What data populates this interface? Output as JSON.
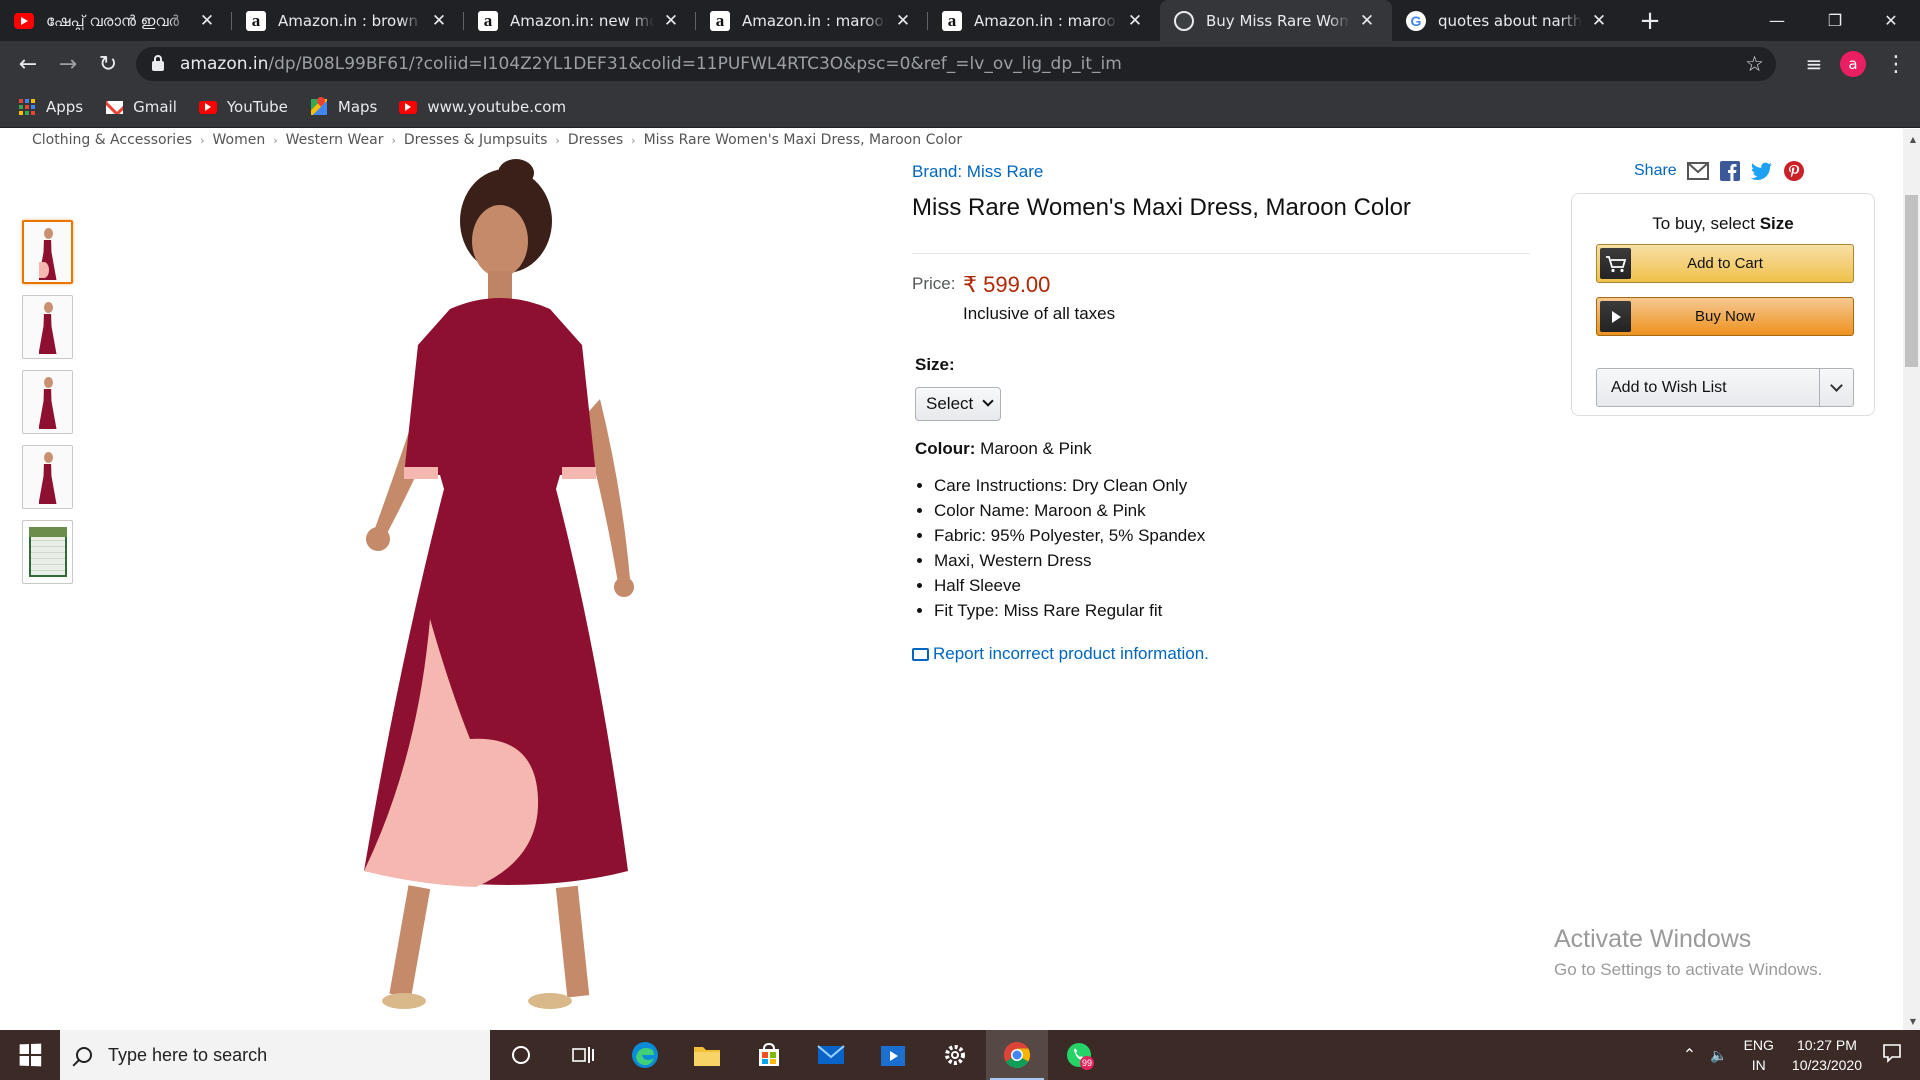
{
  "browser": {
    "tabs": [
      {
        "title": "ഷേപ്പ് വരാൻ ഇവർ",
        "icon": "youtube-icon"
      },
      {
        "title": "Amazon.in : brown blac",
        "icon": "amazon-icon"
      },
      {
        "title": "Amazon.in: new model",
        "icon": "amazon-icon"
      },
      {
        "title": "Amazon.in : maroon dr",
        "icon": "amazon-icon"
      },
      {
        "title": "Amazon.in : maroon dr",
        "icon": "amazon-icon"
      },
      {
        "title": "Buy Miss Rare Women",
        "icon": "globe-icon",
        "active": true
      },
      {
        "title": "quotes about narthaki",
        "icon": "google-icon"
      }
    ],
    "url_host": "amazon.in",
    "url_path": "/dp/B08L99BF61/?coliid=I104Z2YL1DEF31&colid=11PUFWL4RTC3O&psc=0&ref_=lv_ov_lig_dp_it_im",
    "avatar_letter": "a",
    "bookmarks": [
      {
        "label": "Apps",
        "icon": "apps-grid-icon"
      },
      {
        "label": "Gmail",
        "icon": "gmail-icon"
      },
      {
        "label": "YouTube",
        "icon": "youtube-icon"
      },
      {
        "label": "Maps",
        "icon": "maps-icon"
      },
      {
        "label": "www.youtube.com",
        "icon": "youtube-icon"
      }
    ]
  },
  "breadcrumb": [
    "Clothing & Accessories",
    "Women",
    "Western Wear",
    "Dresses & Jumpsuits",
    "Dresses",
    "Miss Rare Women's Maxi Dress, Maroon Color"
  ],
  "product": {
    "brand": "Brand: Miss Rare",
    "title": "Miss Rare Women's Maxi Dress, Maroon Color",
    "price_label": "Price:",
    "price": "₹ 599.00",
    "taxes": "Inclusive of all taxes",
    "size_label": "Size:",
    "size_selected": "Select",
    "colour_label": "Colour:",
    "colour_value": "Maroon & Pink",
    "bullets": [
      "Care Instructions: Dry Clean Only",
      "Color Name: Maroon & Pink",
      "Fabric: 95% Polyester, 5% Spandex",
      "Maxi, Western Dress",
      "Half Sleeve",
      "Fit Type: Miss Rare Regular fit"
    ],
    "report_link": "Report incorrect product information."
  },
  "share": {
    "label": "Share"
  },
  "buybox": {
    "to_buy_prefix": "To buy, select ",
    "to_buy_emphasis": "Size",
    "add_to_cart": "Add to Cart",
    "buy_now": "Buy Now",
    "wish_list": "Add to Wish List"
  },
  "activation": {
    "title": "Activate Windows",
    "subtitle": "Go to Settings to activate Windows."
  },
  "taskbar": {
    "search_placeholder": "Type here to search",
    "whatsapp_badge": "99",
    "lang_line1": "ENG",
    "lang_line2": "IN",
    "time": "10:27 PM",
    "date": "10/23/2020"
  },
  "colors": {
    "price": "#b12704",
    "link": "#0066c0",
    "dress_maroon": "#8e1030",
    "dress_pink": "#f5b8b0",
    "cart_button": "#f0c14b",
    "buy_button": "#ed9220"
  }
}
